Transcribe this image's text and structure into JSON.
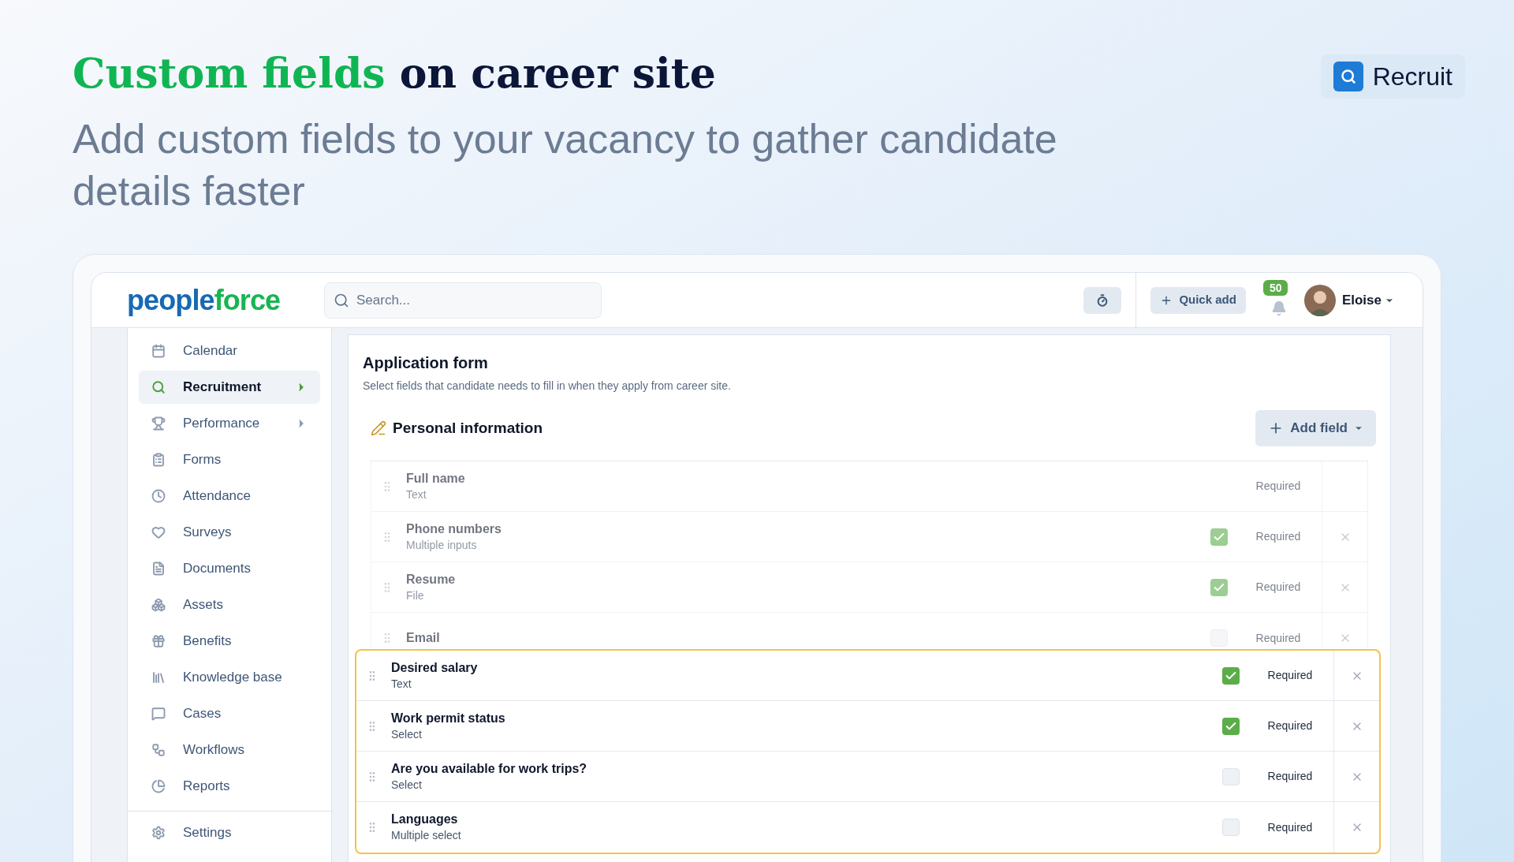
{
  "hero": {
    "title_highlight": "Custom fields",
    "title_rest": "on career site",
    "subtitle": "Add custom fields to your vacancy to gather candidate details faster",
    "badge": "Recruit"
  },
  "app": {
    "logo": {
      "first": "people",
      "second": "force"
    },
    "search": {
      "placeholder": "Search..."
    },
    "quick_add": "Quick add",
    "notifications": "50",
    "user": "Eloise",
    "sidebar": [
      {
        "label": "Calendar",
        "selected": false,
        "submenu": false
      },
      {
        "label": "Recruitment",
        "selected": true,
        "submenu": true
      },
      {
        "label": "Performance",
        "selected": false,
        "submenu": true
      },
      {
        "label": "Forms",
        "selected": false,
        "submenu": false
      },
      {
        "label": "Attendance",
        "selected": false,
        "submenu": false
      },
      {
        "label": "Surveys",
        "selected": false,
        "submenu": false
      },
      {
        "label": "Documents",
        "selected": false,
        "submenu": false
      },
      {
        "label": "Assets",
        "selected": false,
        "submenu": false
      },
      {
        "label": "Benefits",
        "selected": false,
        "submenu": false
      },
      {
        "label": "Knowledge base",
        "selected": false,
        "submenu": false
      },
      {
        "label": "Cases",
        "selected": false,
        "submenu": false
      },
      {
        "label": "Workflows",
        "selected": false,
        "submenu": false
      },
      {
        "label": "Reports",
        "selected": false,
        "submenu": false
      }
    ],
    "settings": "Settings",
    "form": {
      "title": "Application form",
      "description": "Select fields that candidate needs to fill in when they apply from career site.",
      "section": "Personal information",
      "add_field": "Add field",
      "base_fields": [
        {
          "name": "Full name",
          "type": "Text",
          "required_label": "Required",
          "removable": false
        },
        {
          "name": "Phone numbers",
          "type": "Multiple inputs",
          "checked": true,
          "required_label": "Required",
          "removable": true
        },
        {
          "name": "Resume",
          "type": "File",
          "checked": true,
          "required_label": "Required",
          "removable": true
        },
        {
          "name": "Email",
          "checked": false,
          "required_label": "Required",
          "removable": true
        }
      ],
      "custom_fields": [
        {
          "name": "Desired salary",
          "type": "Text",
          "checked": true,
          "required_label": "Required",
          "removable": true
        },
        {
          "name": "Work permit status",
          "type": "Select",
          "checked": true,
          "required_label": "Required",
          "removable": true
        },
        {
          "name": "Are you available for work trips?",
          "type": "Select",
          "checked": false,
          "required_label": "Required",
          "removable": true
        },
        {
          "name": "Languages",
          "type": "Multiple select",
          "checked": false,
          "required_label": "Required",
          "removable": true
        }
      ]
    }
  }
}
